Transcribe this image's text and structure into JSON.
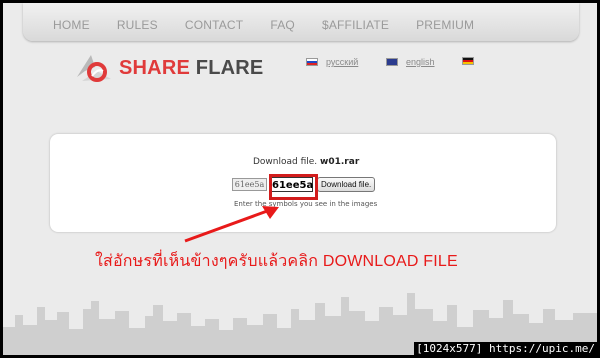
{
  "nav": {
    "items": [
      "HOME",
      "RULES",
      "CONTACT",
      "FAQ",
      "$AFFILIATE",
      "PREMIUM"
    ]
  },
  "logo": {
    "share": "SHARE",
    "flare": "FLARE",
    "mark_color": "#e03a3a"
  },
  "languages": [
    "русский",
    "english"
  ],
  "download": {
    "label": "Download file.",
    "file_name": "w01.rar",
    "captcha_image_text": "61ee5a",
    "captcha_value": "61ee5a",
    "button_label": "Download file.",
    "hint": "Enter the symbols you see in the images"
  },
  "annotation": {
    "text": "ใส่อักษรที่เห็นข้างๆครับแล้วคลิก DOWNLOAD FILE",
    "color": "#e81a1a"
  },
  "watermark": "[1024x577] https://upic.me/"
}
